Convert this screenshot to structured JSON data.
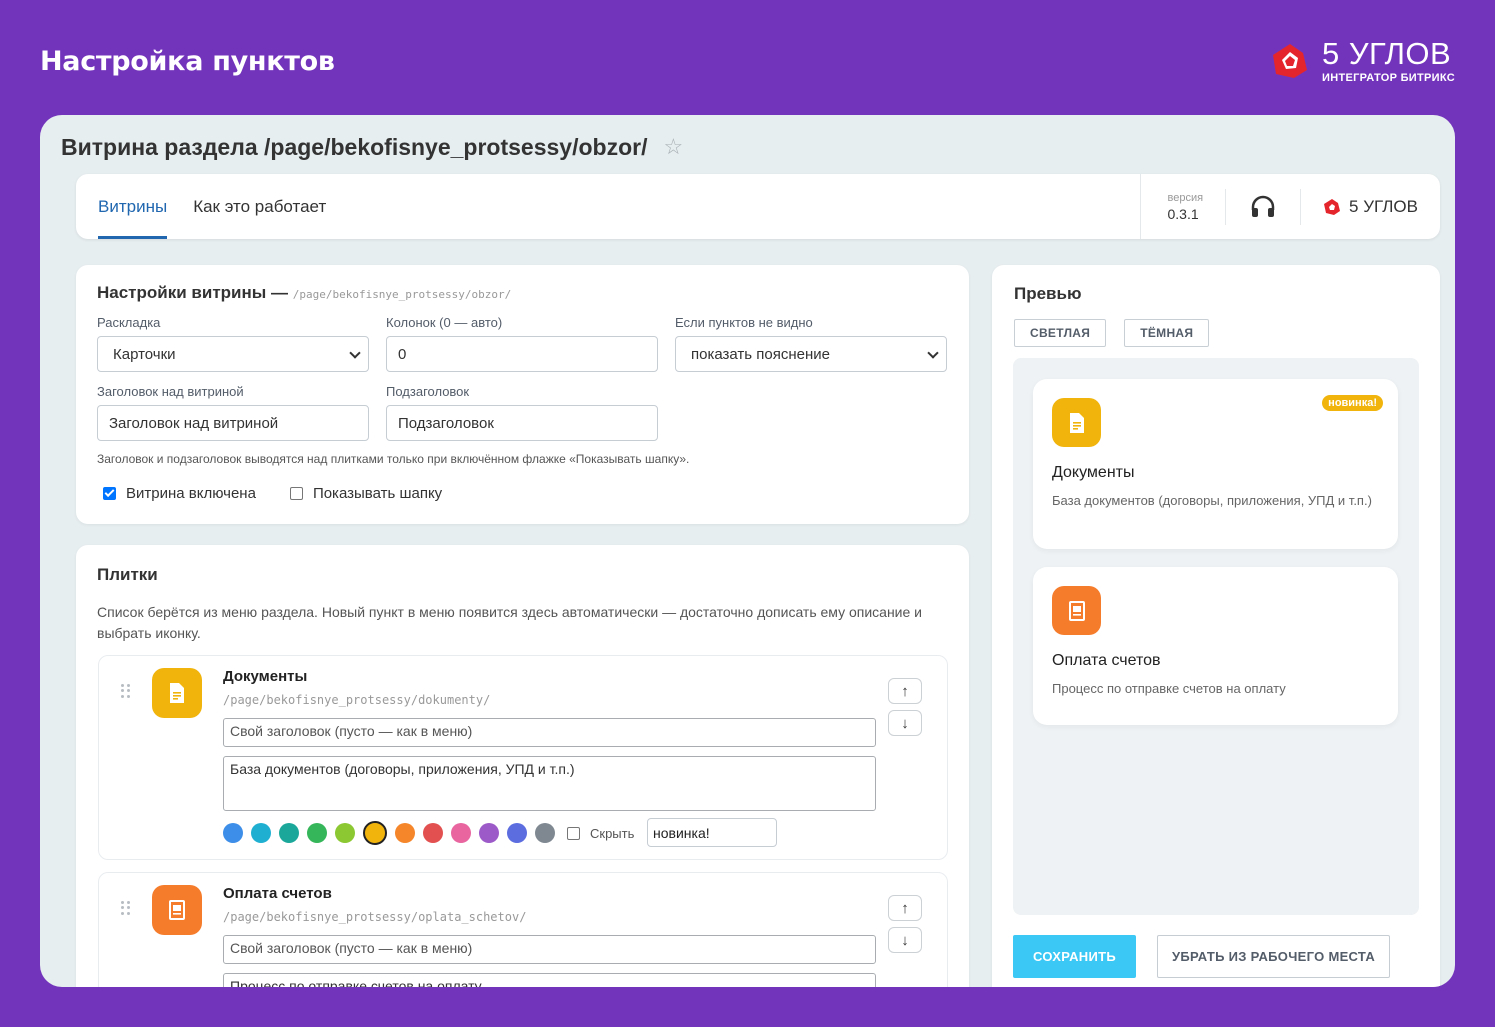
{
  "banner": {
    "title": "Настройка пунктов"
  },
  "logo": {
    "name": "5 УГЛОВ",
    "subtitle": "ИНТЕГРАТОР БИТРИКС"
  },
  "page": {
    "title": "Витрина раздела /page/bekofisnye_protsessy/obzor/"
  },
  "topbar": {
    "tabs": [
      {
        "label": "Витрины",
        "active": true
      },
      {
        "label": "Как это работает",
        "active": false
      }
    ],
    "version_label": "версия",
    "version": "0.3.1",
    "brand_label": "5 УГЛОВ"
  },
  "settings": {
    "title": "Настройки витрины —",
    "path": "/page/bekofisnye_protsessy/obzor/",
    "layout_label": "Раскладка",
    "layout_value": "Карточки",
    "columns_label": "Колонок (0 — авто)",
    "columns_value": "0",
    "empty_label": "Если пунктов не видно",
    "empty_value": "показать пояснение",
    "heading_label": "Заголовок над витриной",
    "heading_value": "Заголовок над витриной",
    "subheading_label": "Подзаголовок",
    "subheading_value": "Подзаголовок",
    "hint": "Заголовок и подзаголовок выводятся над плитками только при включённом флажке «Показывать шапку».",
    "enabled_label": "Витрина включена",
    "enabled": true,
    "show_header_label": "Показывать шапку",
    "show_header": false
  },
  "tiles": {
    "title": "Плитки",
    "description": "Список берётся из меню раздела. Новый пункт в меню появится здесь автоматически — достаточно дописать ему описание и выбрать иконку.",
    "items": [
      {
        "name": "Документы",
        "path": "/page/bekofisnye_protsessy/dokumenty/",
        "title_placeholder": "Свой заголовок (пусто — как в меню)",
        "description": "База документов (договоры, приложения, УПД и т.п.)",
        "color": "#f0b40c",
        "hide_label": "Скрыть",
        "badge": "новинка!",
        "icon": "document-icon"
      },
      {
        "name": "Оплата счетов",
        "path": "/page/bekofisnye_protsessy/oplata_schetov/",
        "title_placeholder": "Свой заголовок (пусто — как в меню)",
        "description": "Процесс по отправке счетов на оплату",
        "color": "#f57c2b",
        "icon": "invoice-icon"
      }
    ],
    "palette": [
      "#3d8ee8",
      "#1fb0d1",
      "#1ba89a",
      "#36b65a",
      "#8bc832",
      "#f0b40c",
      "#f5862a",
      "#e35050",
      "#e865a0",
      "#9c5ac9",
      "#5c6de0",
      "#7f8891"
    ],
    "selected_color_index": 5
  },
  "preview": {
    "title": "Превью",
    "theme_light": "СВЕТЛАЯ",
    "theme_dark": "ТЁМНАЯ",
    "cards": [
      {
        "title": "Документы",
        "desc": "База документов (договоры, приложения, УПД и т.п.)",
        "badge": "новинка!"
      },
      {
        "title": "Оплата счетов",
        "desc": "Процесс по отправке счетов на оплату"
      }
    ],
    "save": "СОХРАНИТЬ",
    "remove": "УБРАТЬ ИЗ РАБОЧЕГО МЕСТА"
  }
}
